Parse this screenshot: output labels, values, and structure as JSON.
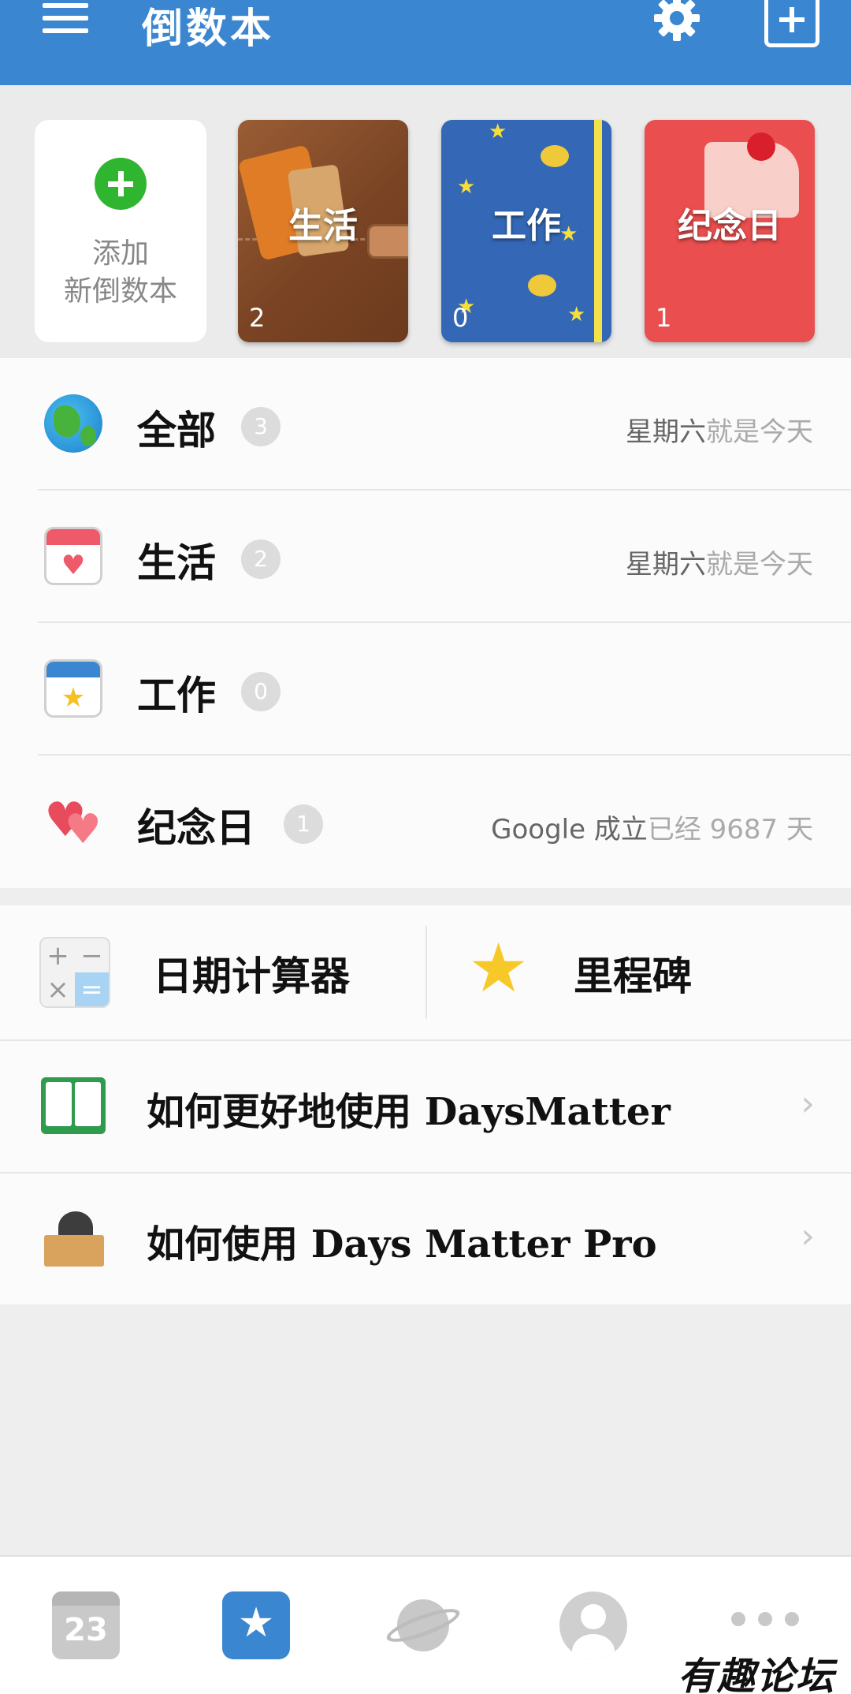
{
  "header": {
    "title": "倒数本",
    "menu_icon": "hamburger-menu-icon",
    "settings_icon": "gear-icon",
    "add_icon": "add-book-icon",
    "accent_color": "#3a86d1"
  },
  "notebooks": {
    "add_card": {
      "line1": "添加",
      "line2": "新倒数本",
      "icon": "plus-circle-icon"
    },
    "items": [
      {
        "title": "生活",
        "count": "2",
        "color": "#8a5130"
      },
      {
        "title": "工作",
        "count": "0",
        "color": "#3468b6"
      },
      {
        "title": "纪念日",
        "count": "1",
        "color": "#ea4e4e"
      }
    ]
  },
  "categories": [
    {
      "label": "全部",
      "badge": "3",
      "side_bold": "星期六",
      "side_dim": "就是今天",
      "icon": "globe-icon"
    },
    {
      "label": "生活",
      "badge": "2",
      "side_bold": "星期六",
      "side_dim": "就是今天",
      "icon": "heart-calendar-icon"
    },
    {
      "label": "工作",
      "badge": "0",
      "side_bold": "",
      "side_dim": "",
      "icon": "star-calendar-icon"
    },
    {
      "label": "纪念日",
      "badge": "1",
      "side_bold": "Google 成立",
      "side_dim": "已经 9687 天",
      "icon": "hearts-icon"
    }
  ],
  "tools": {
    "calculator": {
      "label": "日期计算器",
      "icon": "calculator-icon"
    },
    "milestone": {
      "label": "里程碑",
      "icon": "star-icon"
    }
  },
  "help": [
    {
      "label": "如何更好地使用 DaysMatter",
      "icon": "open-book-icon"
    },
    {
      "label": "如何使用 Days Matter Pro",
      "icon": "cat-box-icon"
    }
  ],
  "chevron": "›",
  "bottom_nav": {
    "calendar_day": "23",
    "books_glyph": "★",
    "items": [
      "calendar-icon",
      "notebook-star-icon",
      "planet-icon",
      "profile-icon",
      "more-icon"
    ]
  },
  "watermark": "有趣论坛"
}
